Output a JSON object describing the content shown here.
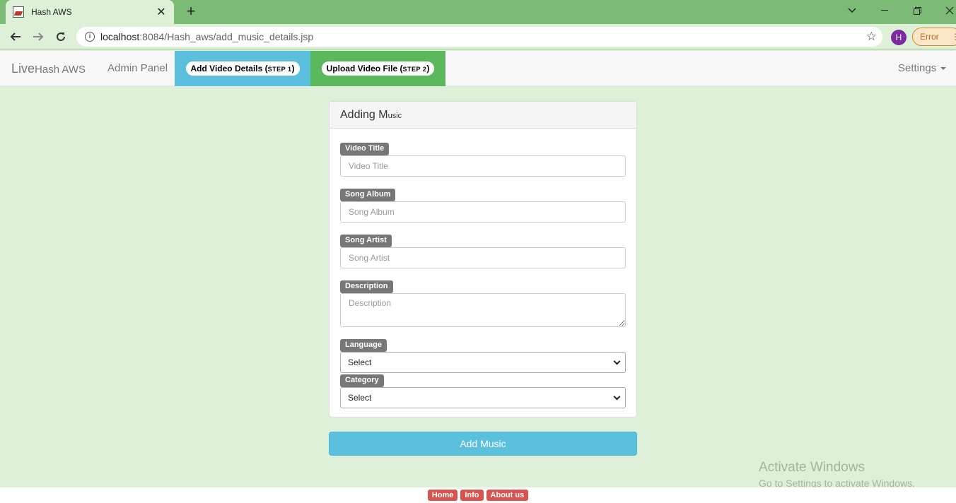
{
  "browser": {
    "tab_title": "Hash AWS",
    "new_tab_label": "+",
    "url_host": "localhost",
    "url_path": ":8084/Hash_aws/add_music_details.jsp",
    "profile_initial": "H",
    "error_label": "Error"
  },
  "navbar": {
    "brand_big": "Live",
    "brand_small": "Hash AWS",
    "admin_link": "Admin Panel",
    "step1_label": "Add Video Details (",
    "step1_step": "STEP 1",
    "step2_label": "Upload Video File (",
    "step2_step": "STEP 2",
    "close_paren": ")",
    "settings_label": "Settings"
  },
  "form": {
    "heading_main": "Adding M",
    "heading_small": "usic",
    "video_title": {
      "label": "Video Title",
      "placeholder": "Video Title",
      "value": ""
    },
    "song_album": {
      "label": "Song Album",
      "placeholder": "Song Album",
      "value": ""
    },
    "song_artist": {
      "label": "Song Artist",
      "placeholder": "Song Artist",
      "value": ""
    },
    "description": {
      "label": "Description",
      "placeholder": "Description",
      "value": ""
    },
    "language": {
      "label": "Language",
      "selected": "Select"
    },
    "category": {
      "label": "Category",
      "selected": "Select"
    },
    "submit_label": "Add Music"
  },
  "watermark": {
    "title": "Activate Windows",
    "subtitle": "Go to Settings to activate Windows."
  },
  "footer": {
    "links": [
      "Home",
      "Info",
      "About us"
    ]
  },
  "colors": {
    "background": "#dff0d8",
    "tabstrip": "#7bbb76",
    "step1": "#5bc0de",
    "step2": "#5cb85c",
    "submit": "#5bc0de",
    "footer_button": "#d9534f"
  }
}
